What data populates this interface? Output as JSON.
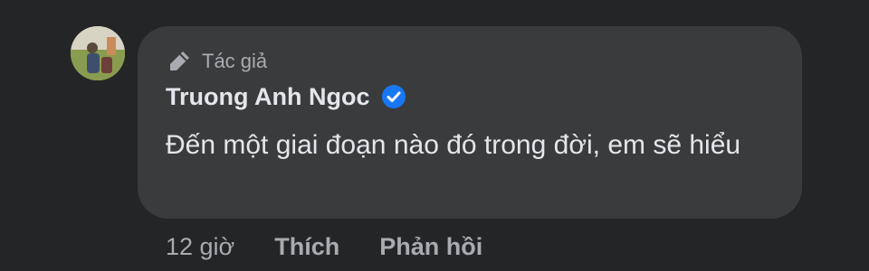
{
  "comment": {
    "badge": "Tác giả",
    "author_name": "Truong Anh Ngoc",
    "text": "Đến một giai đoạn nào đó trong đời, em sẽ hiểu",
    "time": "12 giờ",
    "like_label": "Thích",
    "reply_label": "Phản hồi"
  },
  "colors": {
    "background": "#242526",
    "bubble": "#3a3b3c",
    "primary_text": "#e4e6eb",
    "secondary_text": "#a8abb0",
    "verified": "#1877f2"
  },
  "icons": {
    "badge_icon": "pen-icon",
    "verified_icon": "verified-check-icon"
  }
}
